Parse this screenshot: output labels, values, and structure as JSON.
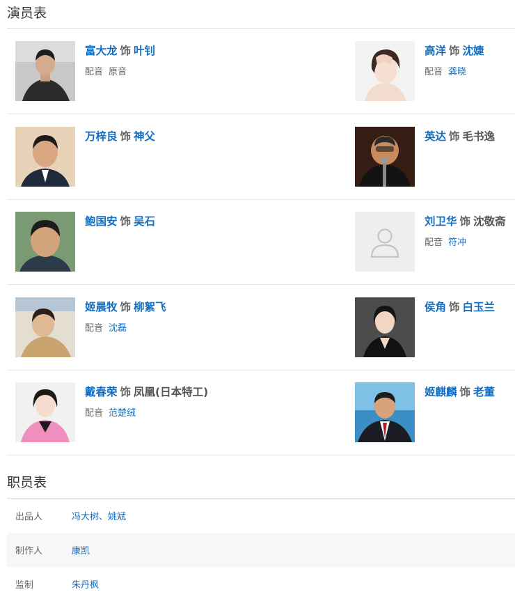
{
  "cast_section": {
    "title": "演员表",
    "dub_label": "配音",
    "as_word": "饰",
    "rows": [
      {
        "left": {
          "actor": "富大龙",
          "role": "叶钊",
          "dub": "原音"
        },
        "right": {
          "actor": "高洋",
          "role": "沈婕",
          "dub": "龚晓"
        }
      },
      {
        "left": {
          "actor": "万梓良",
          "role": "神父"
        },
        "right": {
          "actor": "英达",
          "role": "毛书逸"
        }
      },
      {
        "left": {
          "actor": "鲍国安",
          "role": "吴石"
        },
        "right": {
          "actor": "刘卫华",
          "role": "沈敬斋",
          "dub": "符冲"
        }
      },
      {
        "left": {
          "actor": "姬晨牧",
          "role": "柳絮飞",
          "dub": "沈磊"
        },
        "right": {
          "actor": "侯角",
          "role": "白玉兰"
        }
      },
      {
        "left": {
          "actor": "戴春荣",
          "role": "凤凰(日本特工)",
          "dub": "范楚绒"
        },
        "right": {
          "actor": "姬麒麟",
          "role": "老董"
        }
      }
    ]
  },
  "crew_section": {
    "title": "职员表",
    "rows": [
      {
        "role": "出品人",
        "names": "冯大树、姚斌"
      },
      {
        "role": "制作人",
        "names": "康凯"
      },
      {
        "role": "监制",
        "names": "朱丹枫"
      }
    ]
  }
}
